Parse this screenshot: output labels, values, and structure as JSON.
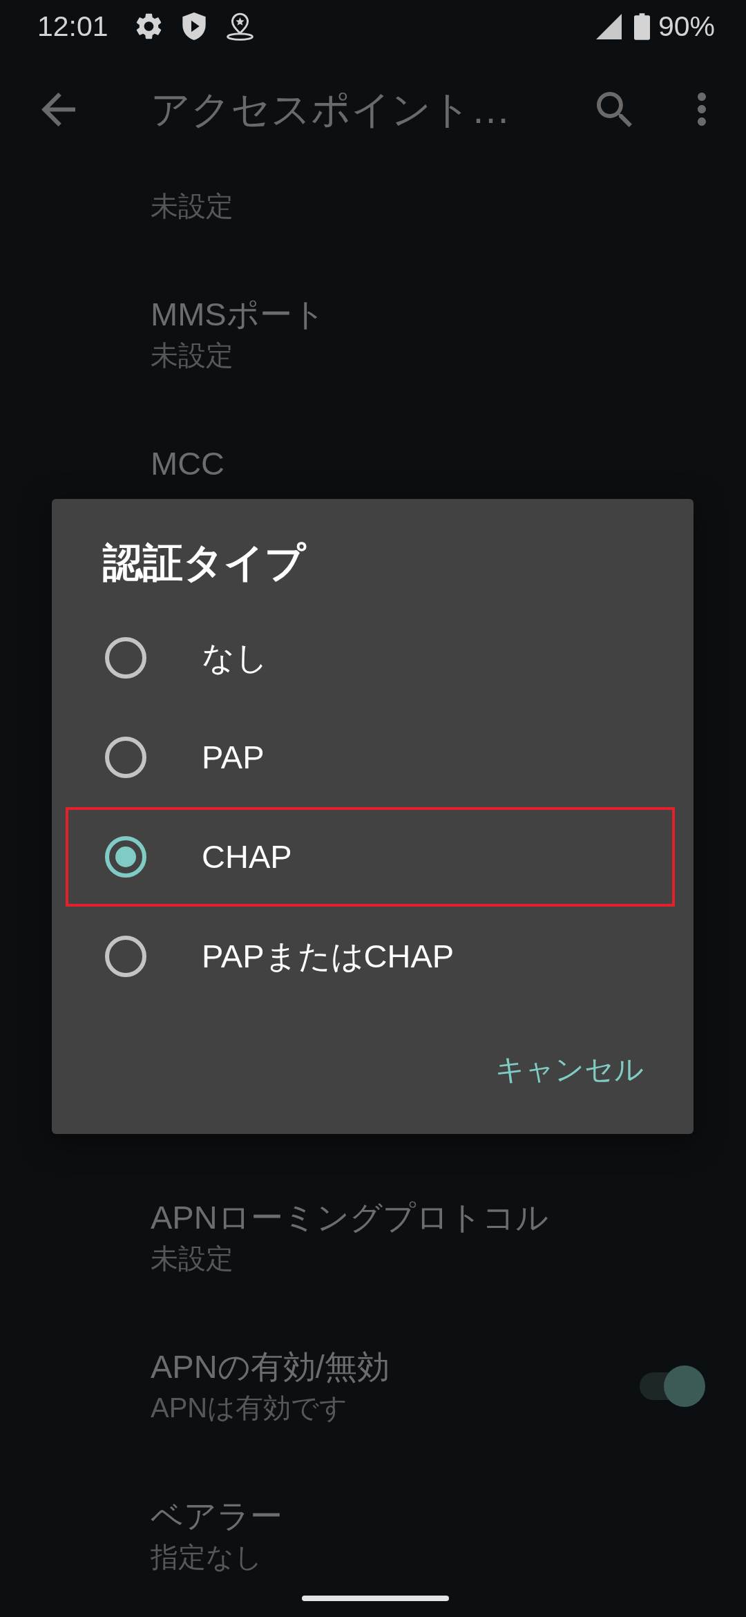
{
  "status_bar": {
    "time": "12:01",
    "battery": "90%"
  },
  "app_bar": {
    "title": "アクセスポイント…"
  },
  "settings": {
    "upper": [
      {
        "summary": "未設定"
      },
      {
        "title": "MMSポート",
        "summary": "未設定"
      },
      {
        "title": "MCC"
      }
    ],
    "lower": [
      {
        "title": "APNローミングプロトコル",
        "summary": "未設定"
      },
      {
        "title": "APNの有効/無効",
        "summary": "APNは有効です",
        "on": true
      },
      {
        "title": "ベアラー",
        "summary": "指定なし"
      }
    ]
  },
  "dialog": {
    "title": "認証タイプ",
    "options": [
      {
        "label": "なし",
        "selected": false,
        "highlighted": false
      },
      {
        "label": "PAP",
        "selected": false,
        "highlighted": false
      },
      {
        "label": "CHAP",
        "selected": true,
        "highlighted": true
      },
      {
        "label": "PAPまたはCHAP",
        "selected": false,
        "highlighted": false
      }
    ],
    "cancel_button": "キャンセル"
  }
}
